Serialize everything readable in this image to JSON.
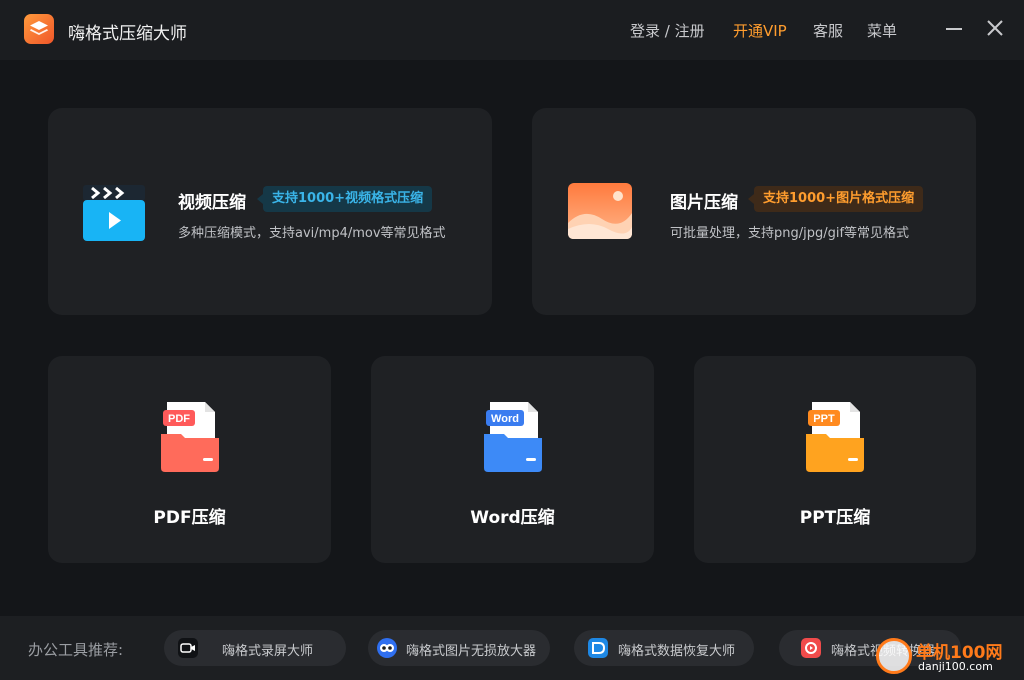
{
  "app": {
    "title": "嗨格式压缩大师"
  },
  "header": {
    "login": "登录 / 注册",
    "vip": "开通VIP",
    "service": "客服",
    "menu": "菜单"
  },
  "cards": {
    "video": {
      "title": "视频压缩",
      "tag": "支持1000+视频格式压缩",
      "desc": "多种压缩模式，支持avi/mp4/mov等常见格式"
    },
    "image": {
      "title": "图片压缩",
      "tag": "支持1000+图片格式压缩",
      "desc": "可批量处理，支持png/jpg/gif等常见格式"
    },
    "pdf": {
      "title": "PDF压缩",
      "badge": "PDF"
    },
    "word": {
      "title": "Word压缩",
      "badge": "Word"
    },
    "ppt": {
      "title": "PPT压缩",
      "badge": "PPT"
    }
  },
  "footer": {
    "label": "办公工具推荐:",
    "tools": [
      {
        "label": "嗨格式录屏大师",
        "icon": "screen-record-icon"
      },
      {
        "label": "嗨格式图片无损放大器",
        "icon": "image-enlarger-icon"
      },
      {
        "label": "嗨格式数据恢复大师",
        "icon": "data-recovery-icon"
      },
      {
        "label": "嗨格式视频转换器",
        "icon": "video-converter-icon"
      }
    ]
  },
  "watermark": {
    "text": "单机100网",
    "url": "danji100.com"
  },
  "colors": {
    "accent": "#ff9d2e",
    "blue_tag": "#3ab4e8",
    "background": "#141619",
    "card": "#1f2124"
  }
}
